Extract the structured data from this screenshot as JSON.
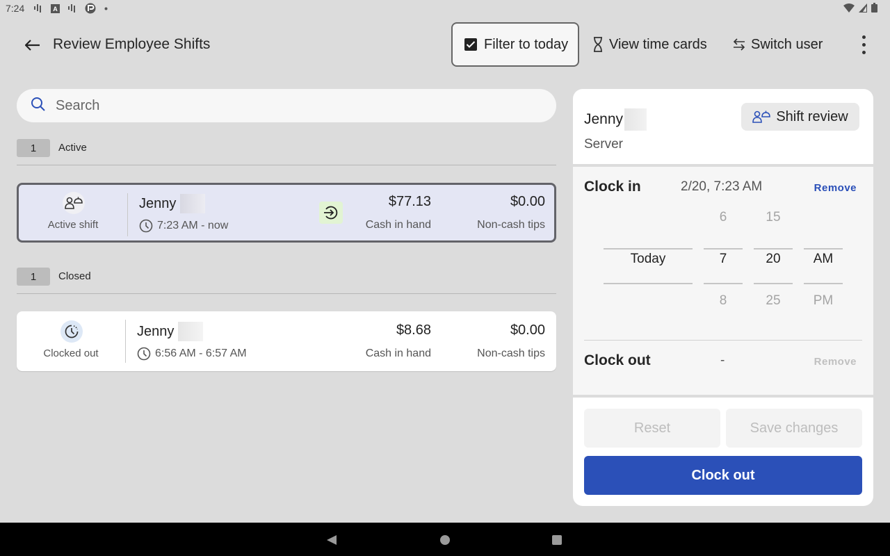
{
  "status_bar": {
    "time": "7:24",
    "left_icons": [
      "signal-bars-icon",
      "text-a-icon",
      "signal-bars-icon",
      "app-badge-icon",
      "dot-icon"
    ],
    "right_icons": [
      "wifi-icon",
      "cell-signal-icon",
      "battery-icon"
    ]
  },
  "header": {
    "title": "Review Employee Shifts",
    "filter_label": "Filter to today",
    "filter_checked": true,
    "view_time_cards_label": "View time cards",
    "switch_user_label": "Switch user"
  },
  "search": {
    "placeholder": "Search",
    "value": ""
  },
  "sections": [
    {
      "count": "1",
      "label": "Active",
      "shifts": [
        {
          "status_label": "Active shift",
          "status_icon": "server-person-icon",
          "employee": "Jenny",
          "time_range": "7:23 AM - now",
          "badge_icon": "clock-in-arrow-icon",
          "cash_in_hand": "$77.13",
          "cash_in_hand_label": "Cash in hand",
          "non_cash_tips": "$0.00",
          "non_cash_tips_label": "Non-cash tips",
          "selected": true
        }
      ]
    },
    {
      "count": "1",
      "label": "Closed",
      "shifts": [
        {
          "status_label": "Clocked out",
          "status_icon": "clock-dashed-icon",
          "employee": "Jenny",
          "time_range": "6:56 AM - 6:57 AM",
          "cash_in_hand": "$8.68",
          "cash_in_hand_label": "Cash in hand",
          "non_cash_tips": "$0.00",
          "non_cash_tips_label": "Non-cash tips",
          "selected": false
        }
      ]
    }
  ],
  "detail": {
    "employee": "Jenny",
    "role": "Server",
    "shift_review_label": "Shift review",
    "clock_in": {
      "label": "Clock in",
      "value": "2/20, 7:23 AM",
      "remove_label": "Remove",
      "remove_enabled": true
    },
    "picker": {
      "day": {
        "prev": "",
        "selected": "Today",
        "next": ""
      },
      "hour": {
        "prev": "6",
        "selected": "7",
        "next": "8"
      },
      "minute": {
        "prev": "15",
        "selected": "20",
        "next": "25"
      },
      "ampm": {
        "prev": "",
        "selected": "AM",
        "next": "PM"
      }
    },
    "clock_out": {
      "label": "Clock out",
      "value": "-",
      "remove_label": "Remove",
      "remove_enabled": false
    },
    "reset_label": "Reset",
    "save_label": "Save changes",
    "clock_out_button_label": "Clock out"
  },
  "colors": {
    "accent": "#2b50b8",
    "active_card_bg": "#e4e6f4",
    "clock_in_badge_bg": "#e2f4d3",
    "background": "#dcdcdc"
  }
}
